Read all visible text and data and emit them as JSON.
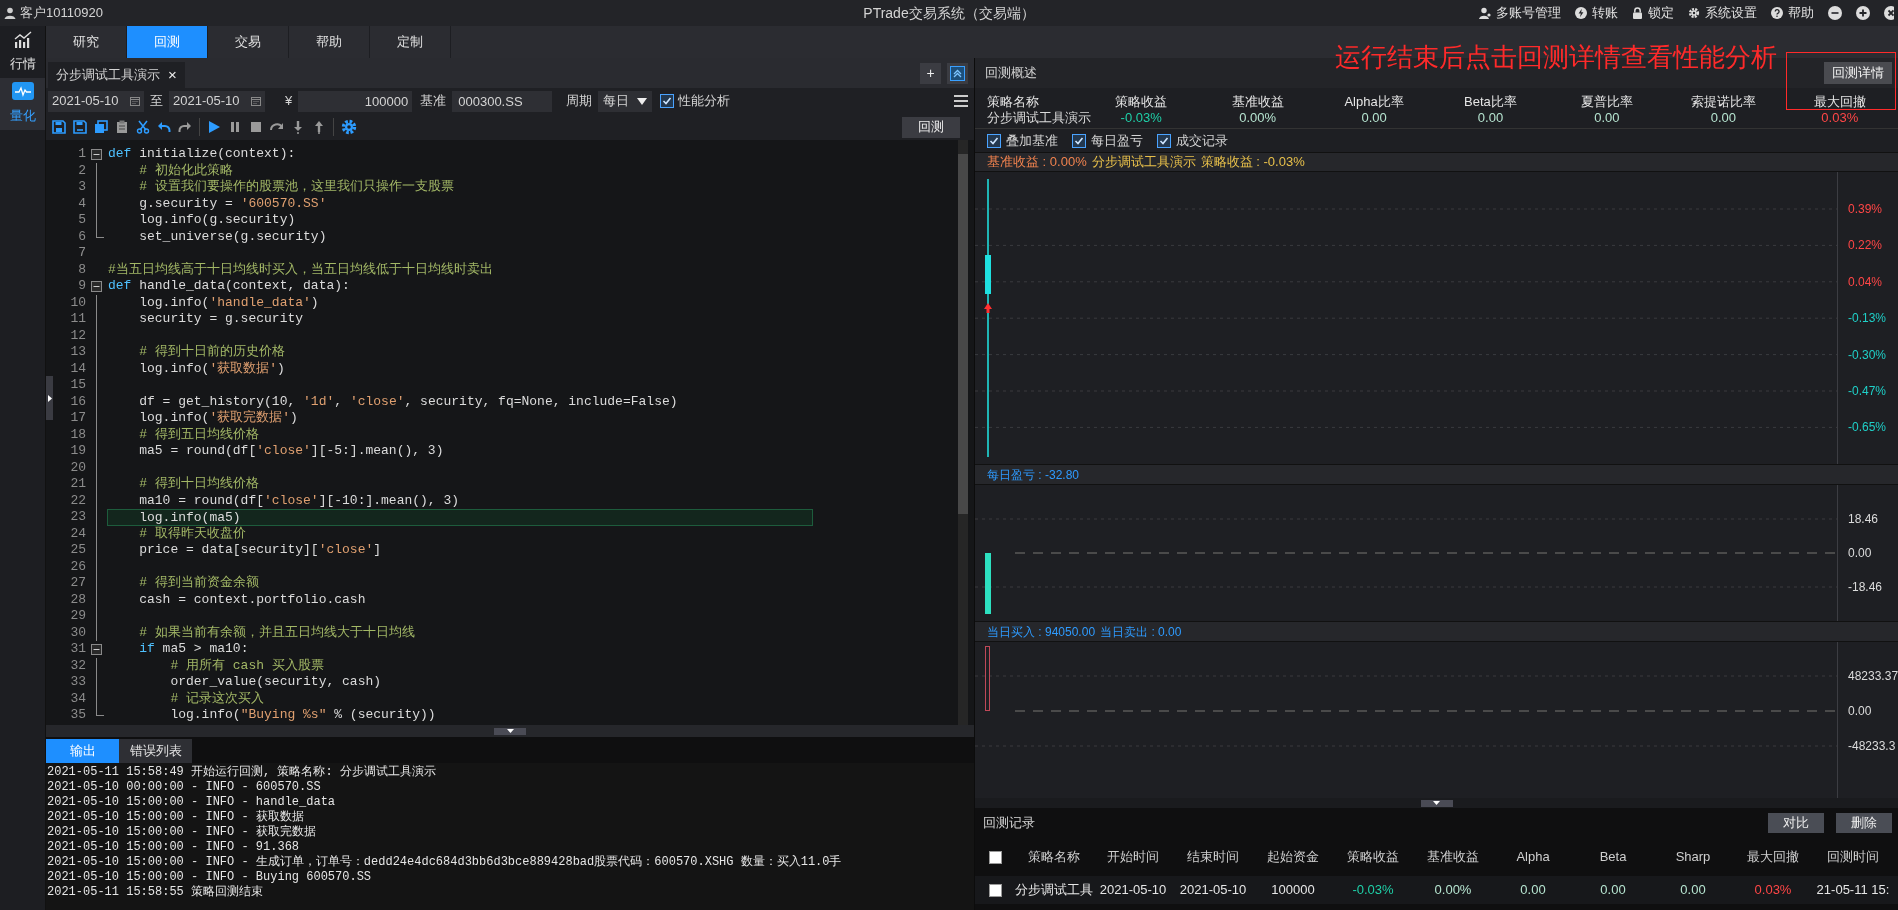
{
  "title_bar": {
    "account": "客户10110920",
    "title": "PTrade交易系统（交易端）",
    "menu": [
      {
        "label": "多账号管理"
      },
      {
        "label": "转账"
      },
      {
        "label": "锁定"
      },
      {
        "label": "系统设置"
      },
      {
        "label": "帮助"
      }
    ]
  },
  "sidebar": [
    {
      "label": "行情",
      "selected": false
    },
    {
      "label": "量化",
      "selected": true
    }
  ],
  "tabs": [
    {
      "label": "研究",
      "selected": false
    },
    {
      "label": "回测",
      "selected": true
    },
    {
      "label": "交易",
      "selected": false
    },
    {
      "label": "帮助",
      "selected": false
    },
    {
      "label": "定制",
      "selected": false
    }
  ],
  "doc_tab": {
    "label": "分步调试工具演示",
    "close": "×",
    "add": "+"
  },
  "params": {
    "start": "2021-05-10",
    "to": "至",
    "end": "2021-05-10",
    "currency": "¥",
    "capital": "100000",
    "benchmark_label": "基准",
    "benchmark": "000300.SS",
    "period_label": "周期",
    "period": "每日",
    "analysis": {
      "label": "性能分析",
      "checked": true
    }
  },
  "run_button": "回测",
  "code": [
    {
      "n": "1",
      "fold": {
        "kind": "start"
      },
      "current": false,
      "tokens": [
        {
          "kind": "keyword",
          "text": "def"
        },
        {
          "kind": "plain",
          "text": " initialize(context):"
        }
      ]
    },
    {
      "n": "2",
      "fold": {
        "kind": "line"
      },
      "current": false,
      "tokens": [
        {
          "kind": "comment",
          "text": "    # 初始化此策略"
        }
      ]
    },
    {
      "n": "3",
      "fold": {
        "kind": "line"
      },
      "current": false,
      "tokens": [
        {
          "kind": "comment",
          "text": "    # 设置我们要操作的股票池，这里我们只操作一支股票"
        }
      ]
    },
    {
      "n": "4",
      "fold": {
        "kind": "line"
      },
      "current": false,
      "tokens": [
        {
          "kind": "plain",
          "text": "    g.security = "
        },
        {
          "kind": "string",
          "text": "'600570.SS'"
        }
      ]
    },
    {
      "n": "5",
      "fold": {
        "kind": "line"
      },
      "current": false,
      "tokens": [
        {
          "kind": "plain",
          "text": "    log.info(g.security)"
        }
      ]
    },
    {
      "n": "6",
      "fold": {
        "kind": "end"
      },
      "current": false,
      "tokens": [
        {
          "kind": "plain",
          "text": "    set_universe(g.security)"
        }
      ]
    },
    {
      "n": "7",
      "current": false
    },
    {
      "n": "8",
      "current": false,
      "tokens": [
        {
          "kind": "comment",
          "text": "#当五日均线高于十日均线时买入，当五日均线低于十日均线时卖出"
        }
      ]
    },
    {
      "n": "9",
      "fold": {
        "kind": "start"
      },
      "current": false,
      "tokens": [
        {
          "kind": "keyword",
          "text": "def"
        },
        {
          "kind": "plain",
          "text": " handle_data(context, data):"
        }
      ]
    },
    {
      "n": "10",
      "fold": {
        "kind": "line"
      },
      "current": false,
      "tokens": [
        {
          "kind": "plain",
          "text": "    log.info("
        },
        {
          "kind": "string",
          "text": "'handle_data'"
        },
        {
          "kind": "plain",
          "text": ")"
        }
      ]
    },
    {
      "n": "11",
      "fold": {
        "kind": "line"
      },
      "current": false,
      "tokens": [
        {
          "kind": "plain",
          "text": "    security = g.security"
        }
      ]
    },
    {
      "n": "12",
      "fold": {
        "kind": "line"
      },
      "current": false
    },
    {
      "n": "13",
      "fold": {
        "kind": "line"
      },
      "current": false,
      "tokens": [
        {
          "kind": "comment",
          "text": "    # 得到十日前的历史价格"
        }
      ]
    },
    {
      "n": "14",
      "fold": {
        "kind": "line"
      },
      "current": false,
      "tokens": [
        {
          "kind": "plain",
          "text": "    log.info("
        },
        {
          "kind": "string",
          "text": "'获取数据'"
        },
        {
          "kind": "plain",
          "text": ")"
        }
      ]
    },
    {
      "n": "15",
      "fold": {
        "kind": "line"
      },
      "current": false
    },
    {
      "n": "16",
      "fold": {
        "kind": "line"
      },
      "current": false,
      "tokens": [
        {
          "kind": "plain",
          "text": "    df = get_history(10, "
        },
        {
          "kind": "string",
          "text": "'1d'"
        },
        {
          "kind": "plain",
          "text": ", "
        },
        {
          "kind": "string",
          "text": "'close'"
        },
        {
          "kind": "plain",
          "text": ", security, fq=None, include=False)"
        }
      ]
    },
    {
      "n": "17",
      "fold": {
        "kind": "line"
      },
      "current": false,
      "tokens": [
        {
          "kind": "plain",
          "text": "    log.info("
        },
        {
          "kind": "string",
          "text": "'获取完数据'"
        },
        {
          "kind": "plain",
          "text": ")"
        }
      ]
    },
    {
      "n": "18",
      "fold": {
        "kind": "line"
      },
      "current": false,
      "tokens": [
        {
          "kind": "comment",
          "text": "    # 得到五日均线价格"
        }
      ]
    },
    {
      "n": "19",
      "fold": {
        "kind": "line"
      },
      "current": false,
      "tokens": [
        {
          "kind": "plain",
          "text": "    ma5 = round(df["
        },
        {
          "kind": "string",
          "text": "'close'"
        },
        {
          "kind": "plain",
          "text": "][-5:].mean(), 3)"
        }
      ]
    },
    {
      "n": "20",
      "fold": {
        "kind": "line"
      },
      "current": false
    },
    {
      "n": "21",
      "fold": {
        "kind": "line"
      },
      "current": false,
      "tokens": [
        {
          "kind": "comment",
          "text": "    # 得到十日均线价格"
        }
      ]
    },
    {
      "n": "22",
      "fold": {
        "kind": "line"
      },
      "current": false,
      "tokens": [
        {
          "kind": "plain",
          "text": "    ma10 = round(df["
        },
        {
          "kind": "string",
          "text": "'close'"
        },
        {
          "kind": "plain",
          "text": "][-10:].mean(), 3)"
        }
      ]
    },
    {
      "n": "23",
      "fold": {
        "kind": "line"
      },
      "current": true,
      "tokens": [
        {
          "kind": "plain",
          "text": "    log.info(ma5)"
        }
      ]
    },
    {
      "n": "24",
      "fold": {
        "kind": "line"
      },
      "current": false,
      "tokens": [
        {
          "kind": "comment",
          "text": "    # 取得昨天收盘价"
        }
      ]
    },
    {
      "n": "25",
      "fold": {
        "kind": "line"
      },
      "current": false,
      "tokens": [
        {
          "kind": "plain",
          "text": "    price = data[security]["
        },
        {
          "kind": "string",
          "text": "'close'"
        },
        {
          "kind": "plain",
          "text": "]"
        }
      ]
    },
    {
      "n": "26",
      "fold": {
        "kind": "line"
      },
      "current": false
    },
    {
      "n": "27",
      "fold": {
        "kind": "line"
      },
      "current": false,
      "tokens": [
        {
          "kind": "comment",
          "text": "    # 得到当前资金余额"
        }
      ]
    },
    {
      "n": "28",
      "fold": {
        "kind": "line"
      },
      "current": false,
      "tokens": [
        {
          "kind": "plain",
          "text": "    cash = context.portfolio.cash"
        }
      ]
    },
    {
      "n": "29",
      "fold": {
        "kind": "line"
      },
      "current": false
    },
    {
      "n": "30",
      "fold": {
        "kind": "line"
      },
      "current": false,
      "tokens": [
        {
          "kind": "comment",
          "text": "    # 如果当前有余额，并且五日均线大于十日均线"
        }
      ]
    },
    {
      "n": "31",
      "fold": {
        "kind": "start"
      },
      "current": false,
      "tokens": [
        {
          "kind": "keyword",
          "text": "    if"
        },
        {
          "kind": "plain",
          "text": " ma5 > ma10:"
        }
      ]
    },
    {
      "n": "32",
      "fold": {
        "kind": "line"
      },
      "current": false,
      "tokens": [
        {
          "kind": "comment",
          "text": "        # 用所有 cash 买入股票"
        }
      ]
    },
    {
      "n": "33",
      "fold": {
        "kind": "line"
      },
      "current": false,
      "tokens": [
        {
          "kind": "plain",
          "text": "        order_value(security, cash)"
        }
      ]
    },
    {
      "n": "34",
      "fold": {
        "kind": "line"
      },
      "current": false,
      "tokens": [
        {
          "kind": "comment",
          "text": "        # 记录这次买入"
        }
      ]
    },
    {
      "n": "35",
      "fold": {
        "kind": "end"
      },
      "current": false,
      "tokens": [
        {
          "kind": "plain",
          "text": "        log.info("
        },
        {
          "kind": "string",
          "text": "\"Buying %s\""
        },
        {
          "kind": "plain",
          "text": " % (security))"
        }
      ]
    }
  ],
  "output_tabs": [
    {
      "label": "输出",
      "selected": true
    },
    {
      "label": "错误列表",
      "selected": false
    }
  ],
  "log": [
    "2021-05-11 15:58:49 开始运行回测, 策略名称: 分步调试工具演示",
    "2021-05-10 00:00:00 - INFO - 600570.SS",
    "2021-05-10 15:00:00 - INFO - handle_data",
    "2021-05-10 15:00:00 - INFO - 获取数据",
    "2021-05-10 15:00:00 - INFO - 获取完数据",
    "2021-05-10 15:00:00 - INFO - 91.368",
    "2021-05-10 15:00:00 - INFO - 生成订单，订单号：dedd24e4dc684d3bb6d3bce889428bad股票代码：600570.XSHG 数量：买入11.0手",
    "2021-05-10 15:00:00 - INFO - Buying 600570.SS",
    "2021-05-11 15:58:55 策略回测结束"
  ],
  "overview": {
    "title": "回测概述",
    "detail_button": "回测详情",
    "annotation": "运行结束后点击回测详情查看性能分析",
    "metrics": [
      {
        "label": "策略名称",
        "value": "分步调试工具演示",
        "color": "#dcdcdc"
      },
      {
        "label": "策略收益",
        "value": "-0.03%",
        "color": "#1fd0a8"
      },
      {
        "label": "基准收益",
        "value": "0.00%",
        "color": "#b5e3cf"
      },
      {
        "label": "Alpha比率",
        "value": "0.00",
        "color": "#b5e3cf"
      },
      {
        "label": "Beta比率",
        "value": "0.00",
        "color": "#b5e3cf"
      },
      {
        "label": "夏普比率",
        "value": "0.00",
        "color": "#b5e3cf"
      },
      {
        "label": "索提诺比率",
        "value": "0.00",
        "color": "#b5e3cf"
      },
      {
        "label": "最大回撤",
        "value": "0.03%",
        "color": "#ff4646"
      }
    ]
  },
  "toggles": [
    {
      "label": "叠加基准",
      "checked": true
    },
    {
      "label": "每日盈亏",
      "checked": true
    },
    {
      "label": "成交记录",
      "checked": true
    }
  ],
  "legend": [
    {
      "text": "基准收益 : 0.00%",
      "color": "#f0824e"
    },
    {
      "text": "分步调试工具演示",
      "color": "#e8c04a"
    },
    {
      "text": "策略收益 : -0.03%",
      "color": "#e8c04a"
    }
  ],
  "return_chart": {
    "y_labels": [
      {
        "text": "0.39%",
        "color": "#ff4646"
      },
      {
        "text": "0.22%",
        "color": "#ff4646"
      },
      {
        "text": "0.04%",
        "color": "#ff4646"
      },
      {
        "text": "-0.13%",
        "color": "#1fd0c8"
      },
      {
        "text": "-0.30%",
        "color": "#1fd0c8"
      },
      {
        "text": "-0.47%",
        "color": "#1fd0c8"
      },
      {
        "text": "-0.65%",
        "color": "#1fd0c8"
      }
    ]
  },
  "pnl_chart": {
    "titles": [
      "每日盈亏 : -32.80"
    ],
    "y_labels": [
      {
        "text": "18.46",
        "color": "#dcdcdc"
      },
      {
        "text": "0.00",
        "color": "#dcdcdc"
      },
      {
        "text": "-18.46",
        "color": "#dcdcdc"
      }
    ]
  },
  "trade_chart": {
    "titles": [
      "当日买入 : 94050.00",
      "当日卖出 : 0.00"
    ],
    "y_labels": [
      {
        "text": "48233.37",
        "color": "#dcdcdc"
      },
      {
        "text": "0.00",
        "color": "#dcdcdc"
      },
      {
        "text": "-48233.3",
        "color": "#dcdcdc"
      }
    ]
  },
  "records": {
    "title": "回测记录",
    "buttons": [
      "对比",
      "删除"
    ],
    "header_checked": false,
    "columns": [
      "策略名称",
      "开始时间",
      "结束时间",
      "起始资金",
      "策略收益",
      "基准收益",
      "Alpha",
      "Beta",
      "Sharp",
      "最大回撤",
      "回测时间"
    ],
    "rows": [
      {
        "checked": false,
        "cells": [
          {
            "text": "分步调试工具",
            "color": "#e6e6e6"
          },
          {
            "text": "2021-05-10",
            "color": "#e6e6e6"
          },
          {
            "text": "2021-05-10",
            "color": "#e6e6e6"
          },
          {
            "text": "100000",
            "color": "#e6e6e6"
          },
          {
            "text": "-0.03%",
            "color": "#1fd0a8"
          },
          {
            "text": "0.00%",
            "color": "#b5e3cf"
          },
          {
            "text": "0.00",
            "color": "#b5e3cf"
          },
          {
            "text": "0.00",
            "color": "#b5e3cf"
          },
          {
            "text": "0.00",
            "color": "#b5e3cf"
          },
          {
            "text": "0.03%",
            "color": "#ff4646"
          },
          {
            "text": "21-05-11 15:",
            "color": "#e6e6e6"
          }
        ]
      }
    ]
  }
}
